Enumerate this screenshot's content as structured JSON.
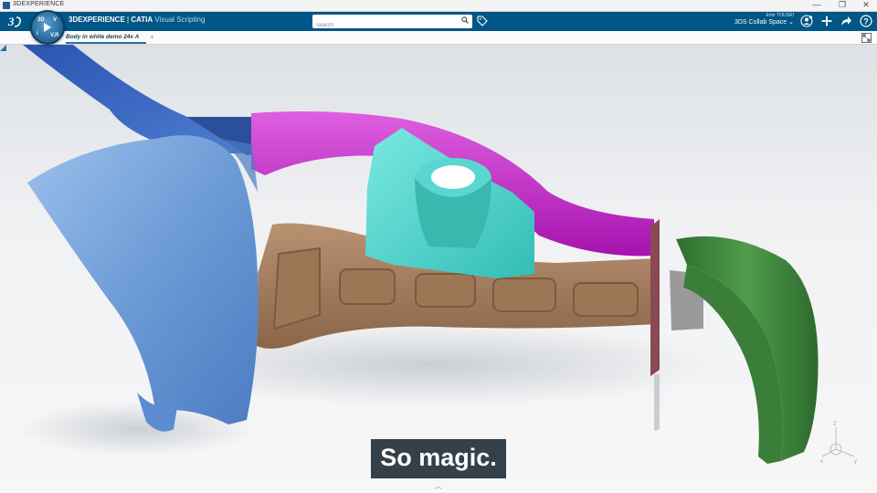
{
  "window": {
    "title": "3DEXPERIENCE",
    "controls": {
      "minimize": "—",
      "maximize": "❐",
      "close": "✕"
    }
  },
  "topbar": {
    "brand_prefix": "3DEXPERIENCE",
    "separator": " | ",
    "brand_product": "CATIA",
    "app_name": " Visual Scripting",
    "compass_quadrants": [
      "3D",
      "V",
      "i",
      "V,R"
    ],
    "search_placeholder": "Search",
    "user_name": "Emir TOUSRI",
    "collab_space": "3DS Collab Space",
    "icons": [
      "3ds-logo",
      "compass-icon",
      "search-icon",
      "tag-icon",
      "share-user-icon",
      "add-icon",
      "share-icon",
      "help-icon"
    ]
  },
  "tabs": {
    "active": "Body in white demo 24x A",
    "add": "+"
  },
  "viewport": {
    "subtitle": "So magic.",
    "triad_labels": {
      "z": "Z",
      "x": "x",
      "y": "y"
    },
    "colors": {
      "part_blue_light": "#6d9bd6",
      "part_blue_dark": "#3c68bf",
      "part_magenta": "#c424c9",
      "part_teal": "#4fd9d2",
      "part_brown": "#a07a58",
      "part_green": "#3f8a3f"
    }
  },
  "colors": {
    "topbar_bg": "#005686",
    "tab_accent": "#2e73a8"
  }
}
